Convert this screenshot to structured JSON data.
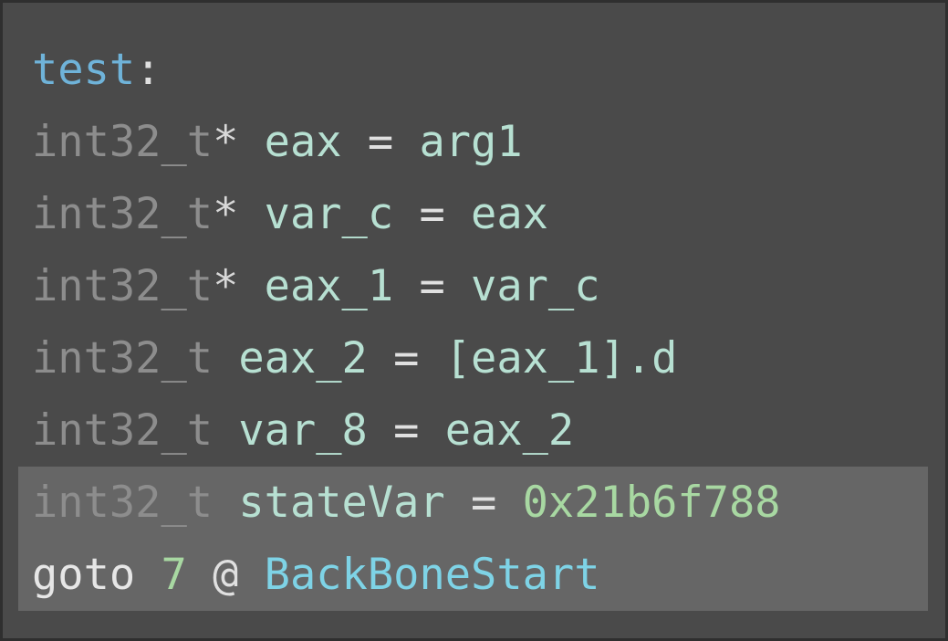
{
  "colors": {
    "background": "#4a4a4a",
    "highlight": "#666666",
    "label": "#6fb3d9",
    "type": "#8d8d8d",
    "variable": "#b7e0d2",
    "number": "#a8d8a2",
    "symbol": "#7ed3e6"
  },
  "code": {
    "label": "test",
    "label_colon": ":",
    "lines": [
      {
        "type": "int32_t",
        "ptr": "*",
        "lhs": "eax",
        "op": "=",
        "rhs": "arg1"
      },
      {
        "type": "int32_t",
        "ptr": "*",
        "lhs": "var_c",
        "op": "=",
        "rhs": "eax"
      },
      {
        "type": "int32_t",
        "ptr": "*",
        "lhs": "eax_1",
        "op": "=",
        "rhs": "var_c"
      },
      {
        "type": "int32_t",
        "ptr": "",
        "lhs": "eax_2",
        "op": "=",
        "rhs": "[eax_1].d"
      },
      {
        "type": "int32_t",
        "ptr": "",
        "lhs": "var_8",
        "op": "=",
        "rhs": "eax_2"
      },
      {
        "type": "int32_t",
        "ptr": "",
        "lhs": "stateVar",
        "op": "=",
        "rhs": "0x21b6f788"
      }
    ],
    "goto": {
      "keyword": "goto",
      "index": "7",
      "at": "@",
      "target": "BackBoneStart"
    }
  }
}
